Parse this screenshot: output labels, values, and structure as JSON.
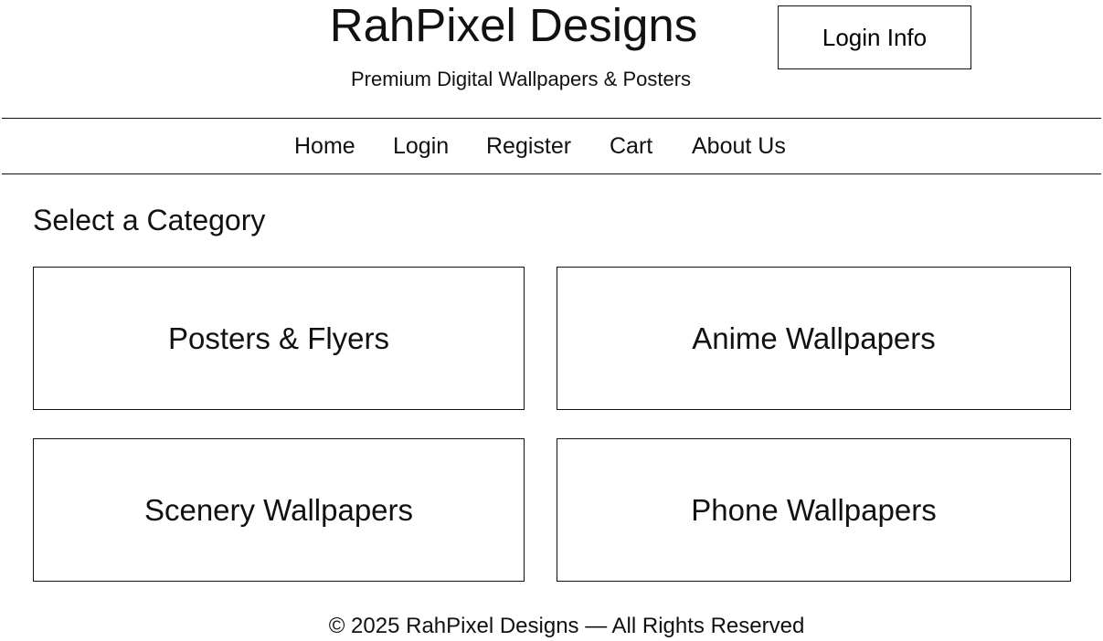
{
  "header": {
    "title": "RahPixel Designs",
    "subtitle": "Premium Digital Wallpapers & Posters",
    "login_info_label": "Login Info"
  },
  "nav": {
    "items": [
      {
        "label": "Home"
      },
      {
        "label": "Login"
      },
      {
        "label": "Register"
      },
      {
        "label": "Cart"
      },
      {
        "label": "About Us"
      }
    ]
  },
  "main": {
    "heading": "Select a Category",
    "categories": [
      {
        "label": "Posters & Flyers"
      },
      {
        "label": "Anime Wallpapers"
      },
      {
        "label": "Scenery Wallpapers"
      },
      {
        "label": "Phone Wallpapers"
      }
    ]
  },
  "footer": {
    "text": "© 2025 RahPixel Designs — All Rights Reserved"
  },
  "colors": {
    "background": "#ffffff",
    "text": "#111111",
    "border": "#111111"
  }
}
